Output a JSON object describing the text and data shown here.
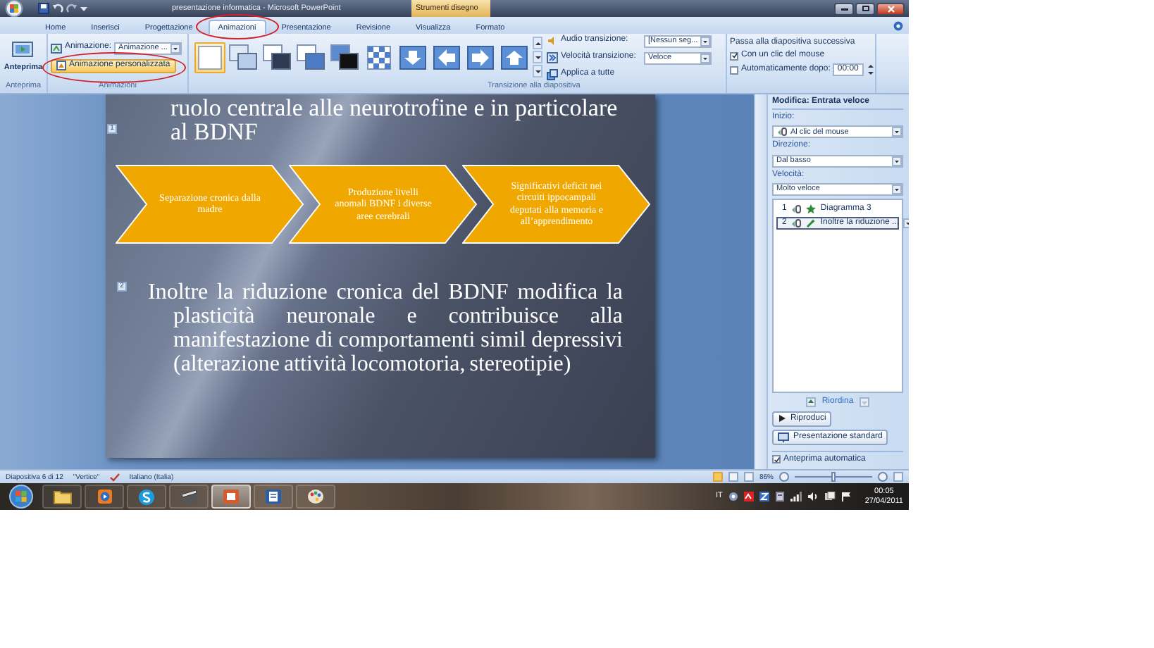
{
  "window": {
    "title": "presentazione informatica - Microsoft PowerPoint",
    "context_tab": "Strumenti disegno"
  },
  "tabs": [
    {
      "label": "Home",
      "selected": false,
      "highlighted": false
    },
    {
      "label": "Inserisci",
      "selected": false,
      "highlighted": false
    },
    {
      "label": "Progettazione",
      "selected": false,
      "highlighted": false
    },
    {
      "label": "Animazioni",
      "selected": true,
      "highlighted": true
    },
    {
      "label": "Presentazione",
      "selected": false,
      "highlighted": false
    },
    {
      "label": "Revisione",
      "selected": false,
      "highlighted": false
    },
    {
      "label": "Visualizza",
      "selected": false,
      "highlighted": false
    },
    {
      "label": "Formato",
      "selected": false,
      "highlighted": false
    }
  ],
  "ribbon": {
    "preview": {
      "label": "Anteprima",
      "group": "Anteprima"
    },
    "animation": {
      "label": "Animazione:",
      "value": "Animazione ...",
      "custom_button": {
        "label": "Animazione personalizzata",
        "highlighted": true
      },
      "group": "Animazioni"
    },
    "transitions": [
      {
        "kind": "blank",
        "selected": true
      },
      {
        "kind": "stack-light",
        "selected": false
      },
      {
        "kind": "stack-dark",
        "selected": false
      },
      {
        "kind": "stack-blue",
        "selected": false
      },
      {
        "kind": "stack-black",
        "selected": false
      },
      {
        "kind": "checker",
        "selected": false
      },
      {
        "kind": "arrow-down",
        "selected": false
      },
      {
        "kind": "arrow-left",
        "selected": false
      },
      {
        "kind": "arrow-right",
        "selected": false
      },
      {
        "kind": "arrow-up",
        "selected": false
      }
    ],
    "sound": {
      "label": "Audio transizione:",
      "value": "[Nessun seg..."
    },
    "speed": {
      "label": "Velocità transizione:",
      "value": "Veloce"
    },
    "apply_all": "Applica a tutte",
    "transition_group": "Transizione alla diapositiva",
    "advance": {
      "title": "Passa alla diapositiva successiva",
      "on_click": {
        "label": "Con un clic del mouse",
        "checked": true
      },
      "after": {
        "label": "Automaticamente dopo:",
        "checked": false,
        "value": "00:00"
      }
    }
  },
  "slide": {
    "title_tag": "1",
    "title_text": "ruolo centrale alle neurotrofine e in particolare al BDNF",
    "steps": [
      "Separazione cronica dalla madre",
      "Produzione livelli anomali BDNF i diverse aree cerebrali",
      "Significativi deficit nei circuiti ippocampali deputati alla memoria e all’apprendimento"
    ],
    "body_tag": "2",
    "body": "Inoltre la riduzione cronica del BDNF modifica la plasticità neuronale e contribuisce alla manifestazione di comportamenti simil depressivi (alterazione attività locomotoria, stereotipie)"
  },
  "pane": {
    "heading": "Modifica: Entrata veloce",
    "fields": [
      {
        "label": "Inizio:",
        "value": "Al clic del mouse",
        "kind": "trigger"
      },
      {
        "label": "Direzione:",
        "value": "Dal basso",
        "kind": "plain"
      },
      {
        "label": "Velocità:",
        "value": "Molto veloce",
        "kind": "plain"
      }
    ],
    "items": [
      {
        "order": "1",
        "name": "Diagramma 3",
        "kind": "star",
        "selected": false
      },
      {
        "order": "2",
        "name": "Inoltre la riduzione ...",
        "kind": "wand",
        "selected": true
      }
    ],
    "reorder": "Riordina",
    "play": "Riproduci",
    "slideshow": "Presentazione standard",
    "autopreview": {
      "label": "Anteprima automatica",
      "checked": true
    }
  },
  "status_bar": {
    "slide": "Diapositiva 6 di 12",
    "theme": "\"Vertice\"",
    "language": "Italiano (Italia)",
    "zoom": "86%",
    "zoom_slider": {
      "level": 0.5
    }
  },
  "taskbar": {
    "apps": [
      {
        "kind": "folder",
        "active": false
      },
      {
        "kind": "media",
        "active": false
      },
      {
        "kind": "chat",
        "active": false
      },
      {
        "kind": "clapper",
        "active": false
      },
      {
        "kind": "slides",
        "active": true
      },
      {
        "kind": "document",
        "active": false
      },
      {
        "kind": "palette",
        "active": false
      }
    ],
    "language": "IT",
    "time": "00:05",
    "date": "27/04/2011"
  }
}
